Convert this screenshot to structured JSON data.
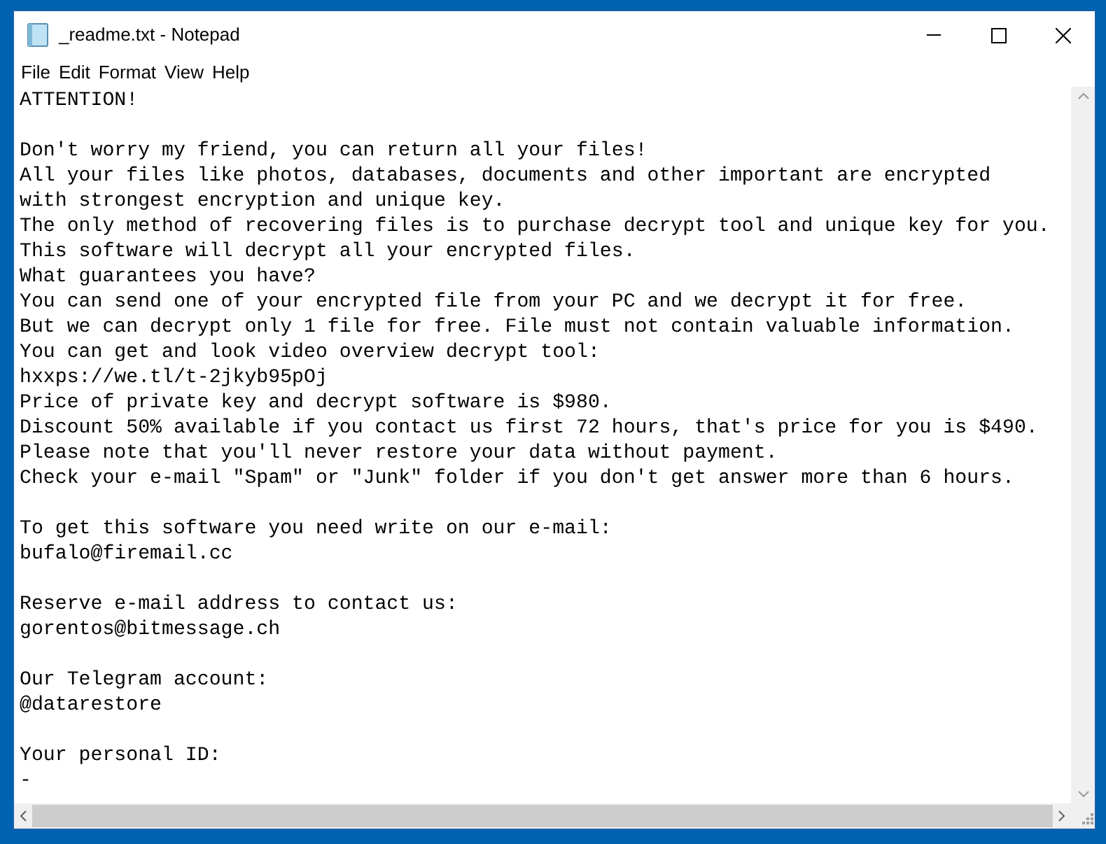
{
  "window": {
    "title": "_readme.txt - Notepad"
  },
  "menu": [
    "File",
    "Edit",
    "Format",
    "View",
    "Help"
  ],
  "document": {
    "paragraphs": [
      {
        "lines": [
          "ATTENTION!"
        ]
      },
      {
        "lines": [
          "Don't worry my friend, you can return all your files!",
          "All your files like photos, databases, documents and other important are encrypted",
          "with strongest encryption and unique key.",
          "The only method of recovering files is to purchase decrypt tool and unique key for you.",
          "This software will decrypt all your encrypted files.",
          "What guarantees you have?",
          "You can send one of your encrypted file from your PC and we decrypt it for free.",
          "But we can decrypt only 1 file for free. File must not contain valuable information.",
          "You can get and look video overview decrypt tool:",
          "hxxps://we.tl/t-2jkyb95pOj",
          "Price of private key and decrypt software is $980.",
          "Discount 50% available if you contact us first 72 hours, that's price for you is $490.",
          "Please note that you'll never restore your data without payment.",
          "Check your e-mail \"Spam\" or \"Junk\" folder if you don't get answer more than 6 hours."
        ]
      },
      {
        "lines": [
          "To get this software you need write on our e-mail:",
          "bufalo@firemail.cc"
        ]
      },
      {
        "lines": [
          "Reserve e-mail address to contact us:",
          "gorentos@bitmessage.ch"
        ]
      },
      {
        "lines": [
          "Our Telegram account:",
          "@datarestore"
        ]
      },
      {
        "lines": [
          "Your personal ID:",
          "-"
        ]
      }
    ]
  }
}
